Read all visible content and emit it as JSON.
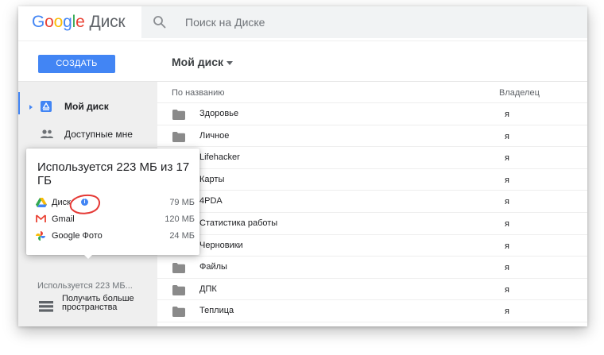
{
  "header": {
    "logo_letters": [
      "G",
      "o",
      "o",
      "g",
      "l",
      "e"
    ],
    "product_name": "Диск",
    "search_placeholder": "Поиск на Диске"
  },
  "toolbar": {
    "create_label": "СОЗДАТЬ",
    "location_title": "Мой диск"
  },
  "sidebar": {
    "items": [
      {
        "label": "Мой диск",
        "icon": "drive-icon",
        "active": true
      },
      {
        "label": "Доступные мне",
        "icon": "shared-people-icon",
        "active": false
      }
    ],
    "storage_used": "Используется 223 МБ...",
    "get_more": "Получить больше пространства"
  },
  "file_list": {
    "columns": {
      "name": "По названию",
      "owner": "Владелец"
    },
    "rows": [
      {
        "name": "Здоровье",
        "owner": "я"
      },
      {
        "name": "Личное",
        "owner": "я"
      },
      {
        "name": "Lifehacker",
        "owner": "я"
      },
      {
        "name": "Карты",
        "owner": "я"
      },
      {
        "name": "4PDA",
        "owner": "я"
      },
      {
        "name": "Статистика работы",
        "owner": "я"
      },
      {
        "name": "Черновики",
        "owner": "я"
      },
      {
        "name": "Файлы",
        "owner": "я"
      },
      {
        "name": "ДПК",
        "owner": "я"
      },
      {
        "name": "Теплица",
        "owner": "я"
      }
    ]
  },
  "storage_popup": {
    "title": "Используется 223 МБ из 17 ГБ",
    "items": [
      {
        "label": "Диск",
        "value": "79 МБ",
        "icon": "drive-triangle-icon"
      },
      {
        "label": "Gmail",
        "value": "120 МБ",
        "icon": "gmail-icon"
      },
      {
        "label": "Google Фото",
        "value": "24 МБ",
        "icon": "photos-pinwheel-icon"
      }
    ],
    "info_icon": "i"
  },
  "colors": {
    "accent": "#4285f4",
    "sidebar_bg": "#efefef",
    "annotation": "#e53935"
  }
}
